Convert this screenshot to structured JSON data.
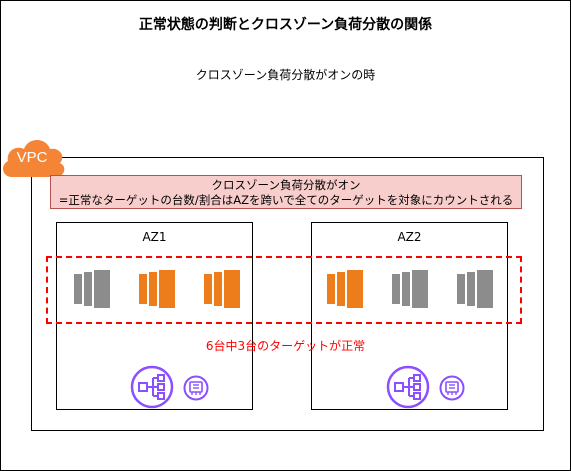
{
  "title": "正常状態の判断とクロスゾーン負荷分散の関係",
  "subtitle": "クロスゾーン負荷分散がオンの時",
  "vpc_label": "VPC",
  "note": {
    "line1": "クロスゾーン負荷分散がオン",
    "line2": "=正常なターゲットの台数/割合はAZを跨いで全てのターゲットを対象にカウントされる"
  },
  "zones": [
    {
      "label": "AZ1",
      "instances": [
        {
          "icon": "ec2-instance-icon",
          "state": "unhealthy"
        },
        {
          "icon": "ec2-instance-icon",
          "state": "healthy"
        },
        {
          "icon": "ec2-instance-icon",
          "state": "healthy"
        }
      ]
    },
    {
      "label": "AZ2",
      "instances": [
        {
          "icon": "ec2-instance-icon",
          "state": "healthy"
        },
        {
          "icon": "ec2-instance-icon",
          "state": "unhealthy"
        },
        {
          "icon": "ec2-instance-icon",
          "state": "unhealthy"
        }
      ]
    }
  ],
  "healthy_summary": "6台中3台のターゲットが正常",
  "colors": {
    "healthy": "#ed7d1a",
    "unhealthy": "#8c8c8c",
    "load_balancer": "#8c4fff",
    "vpc": "#f58536",
    "dashed_border": "#ff0000",
    "note_fill": "#f8cecc"
  },
  "icons": {
    "load_balancer": "elastic-load-balancer-icon",
    "lb_tag": "ip-address-icon"
  }
}
